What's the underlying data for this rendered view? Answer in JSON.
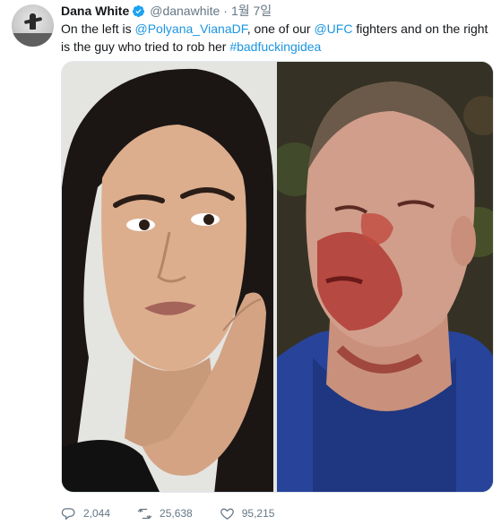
{
  "tweet": {
    "author_name": "Dana White",
    "author_handle": "@danawhite",
    "separator": "·",
    "time": "1월 7일",
    "text": {
      "part1": "On the left is ",
      "mention1": "@Polyana_VianaDF",
      "part2": ", one of our ",
      "mention2": "@UFC",
      "part3": " fighters and on the right is the guy who tried to rob her ",
      "hashtag": "#badfuckingidea"
    },
    "media_count": 2
  },
  "actions": {
    "replies": "2,044",
    "retweets": "25,638",
    "likes": "95,215"
  },
  "icons": {
    "verified": "verified-badge-icon",
    "reply": "reply-icon",
    "retweet": "retweet-icon",
    "like": "heart-icon"
  },
  "colors": {
    "link": "#1b95e0",
    "verified": "#1da1f2",
    "muted": "#657786"
  }
}
